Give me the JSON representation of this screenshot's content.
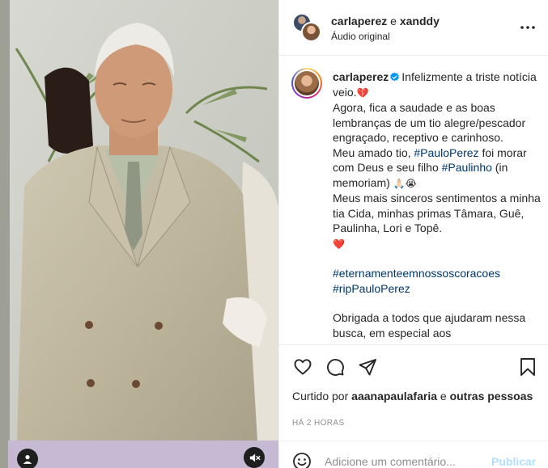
{
  "header": {
    "user1": "carlaperez",
    "connector": "e",
    "user2": "xanddy",
    "audio": "Áudio original"
  },
  "caption": {
    "username": "carlaperez",
    "line1": "Infelizmente a triste notícia veio.",
    "emoji1": "💔",
    "line2": "Agora, fica a saudade e as boas lembranças de um tio alegre/pescador engraçado, receptivo e carinhoso.",
    "line3a": "Meu amado tio, ",
    "tag1": "#PauloPerez",
    "line3b": " foi morar com Deus e seu filho ",
    "tag2": "#Paulinho",
    "line3c": " (in memoriam) ",
    "emoji2": "🙏🏻😭",
    "line4": "Meus mais sinceros sentimentos a minha tia Cida, minhas primas Tâmara, Guê, Paulinha, Lori e Topê.",
    "emoji3": "❤️",
    "hashtag_a": "#eternamenteemnossoscoracoes",
    "hashtag_b": "#ripPauloPerez",
    "line5": "Obrigada a todos que ajudaram nessa busca, em especial aos"
  },
  "likes": {
    "prefix": "Curtido por",
    "user": "aaanapaulafaria",
    "mid": "e",
    "others": "outras pessoas"
  },
  "timestamp": "HÁ 2 HORAS",
  "comment": {
    "placeholder": "Adicione um comentário...",
    "post_label": "Publicar"
  },
  "icons": {
    "like": "heart-icon",
    "comment": "comment-icon",
    "share": "send-icon",
    "save": "bookmark-icon",
    "more": "more-icon",
    "emoji": "emoji-icon",
    "mute": "muted-speaker-icon",
    "tags": "user-tag-icon",
    "verified": "verified-badge-icon"
  },
  "colors": {
    "link": "#00376b",
    "post_disabled": "#b2dffc",
    "verified": "#0095f6",
    "muted_text": "#8e8e8e"
  }
}
